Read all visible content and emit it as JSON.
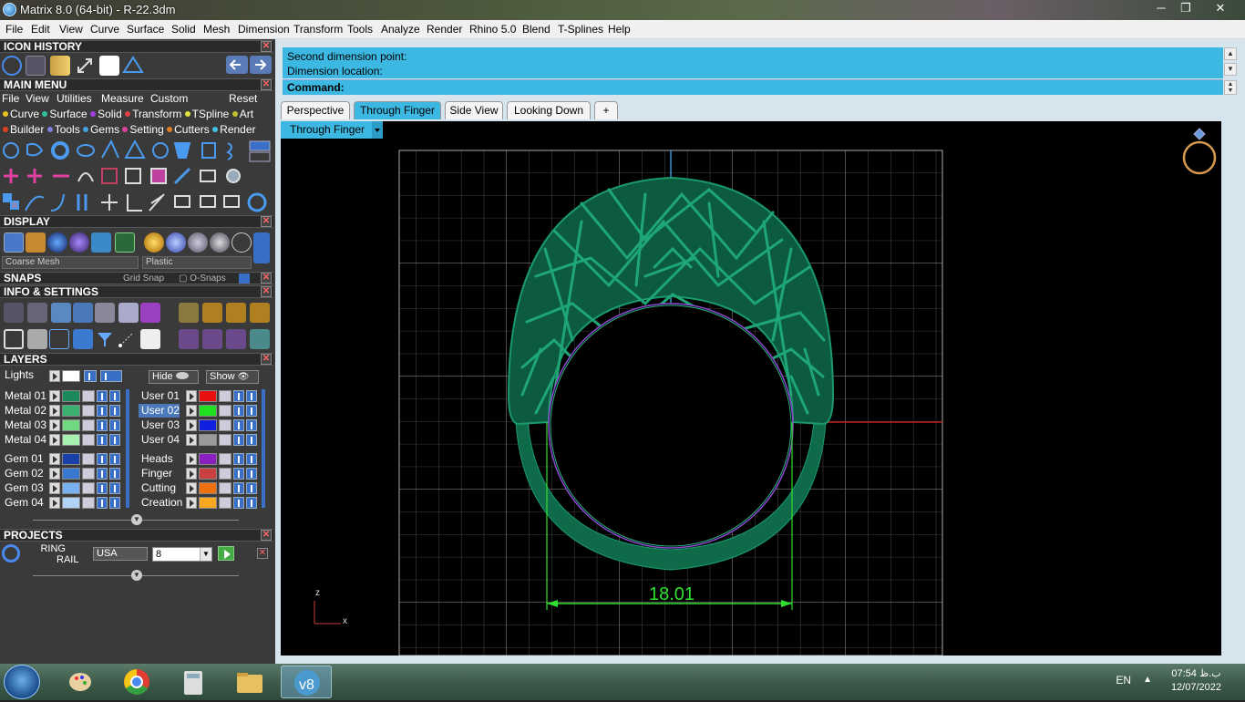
{
  "window": {
    "title": "Matrix 8.0 (64-bit) - R-22.3dm",
    "controls": [
      "─",
      "❐",
      "✕"
    ]
  },
  "menubar": [
    "File",
    "Edit",
    "View",
    "Curve",
    "Surface",
    "Solid",
    "Mesh",
    "Dimension",
    "Transform",
    "Tools",
    "Analyze",
    "Render",
    "Rhino 5.0",
    "Blend",
    "T-Splines",
    "Help"
  ],
  "panel": {
    "icon_history": "ICON HISTORY",
    "main_menu": "MAIN MENU",
    "main_menu_items": [
      "File",
      "View",
      "Utilities",
      "Measure",
      "Custom"
    ],
    "reset": "Reset",
    "categories_row1": [
      {
        "label": "Curve",
        "color": "#e8c020"
      },
      {
        "label": "Surface",
        "color": "#30c0a0"
      },
      {
        "label": "Solid",
        "color": "#a040e0"
      },
      {
        "label": "Transform",
        "color": "#e04040"
      },
      {
        "label": "TSpline",
        "color": "#e0e040"
      },
      {
        "label": "Art",
        "color": "#c0c030"
      }
    ],
    "categories_row2": [
      {
        "label": "Builder",
        "color": "#e04020"
      },
      {
        "label": "Tools",
        "color": "#8080e0"
      },
      {
        "label": "Gems",
        "color": "#40a0e0"
      },
      {
        "label": "Setting",
        "color": "#e040a0"
      },
      {
        "label": "Cutters",
        "color": "#e08020"
      },
      {
        "label": "Render",
        "color": "#40c0e0"
      }
    ],
    "display": "DISPLAY",
    "display_mesh": "Coarse Mesh",
    "display_material": "Plastic",
    "snaps": "SNAPS",
    "grid_snap": "Grid Snap",
    "o_snaps": "O-Snaps",
    "info_settings": "INFO & SETTINGS",
    "layers": "LAYERS",
    "lights": "Lights",
    "hide": "Hide",
    "show": "Show",
    "layer_rows_left": [
      {
        "name": "Metal 01",
        "color": "#1a8a5a"
      },
      {
        "name": "Metal 02",
        "color": "#3ab070"
      },
      {
        "name": "Metal 03",
        "color": "#70d880"
      },
      {
        "name": "Metal 04",
        "color": "#a8f0b0"
      },
      {
        "name": "Gem 01",
        "color": "#1840a8"
      },
      {
        "name": "Gem 02",
        "color": "#3878d0"
      },
      {
        "name": "Gem 03",
        "color": "#78b0f0"
      },
      {
        "name": "Gem 04",
        "color": "#b0d4f8"
      }
    ],
    "layer_rows_right": [
      {
        "name": "User 01",
        "color": "#e81010",
        "selected": false
      },
      {
        "name": "User 02",
        "color": "#20e020",
        "selected": true
      },
      {
        "name": "User 03",
        "color": "#1020e0",
        "selected": false
      },
      {
        "name": "User 04",
        "color": "#9a9a9a",
        "selected": false
      },
      {
        "name": "Heads",
        "color": "#8a20c0",
        "selected": false
      },
      {
        "name": "Finger",
        "color": "#c84040",
        "selected": false
      },
      {
        "name": "Cutting",
        "color": "#f07010",
        "selected": false
      },
      {
        "name": "Creation",
        "color": "#f8a820",
        "selected": false
      }
    ],
    "projects": "PROJECTS",
    "project_name_1": "RING",
    "project_name_2": "RAIL",
    "ring_standard": "USA",
    "ring_size": "8"
  },
  "command": {
    "line1": "Second dimension point:",
    "line2": "Dimension location:",
    "prompt": "Command:"
  },
  "tabs": [
    "Perspective",
    "Through Finger",
    "Side View",
    "Looking Down",
    "+"
  ],
  "active_tab": "Through Finger",
  "viewport": {
    "label": "Through Finger",
    "dimension": "18.01",
    "axis_z": "z",
    "axis_x": "x"
  },
  "taskbar": {
    "lang": "EN",
    "time": "07:54 ب.ظ",
    "date": "12/07/2022"
  },
  "colors": {
    "accent": "#3cb8e2",
    "ring": "#0f7a5a",
    "dimension": "#30e030"
  }
}
